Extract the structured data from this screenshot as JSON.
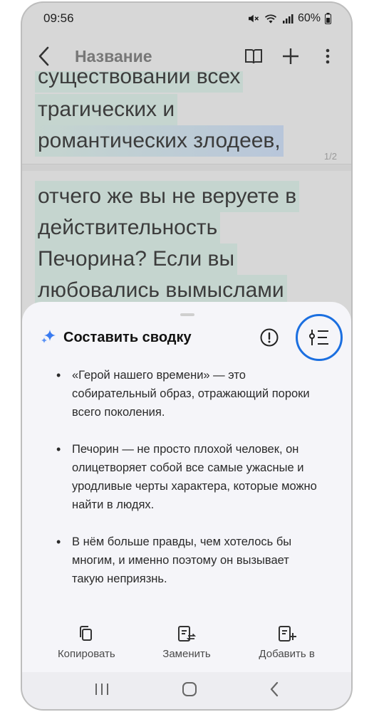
{
  "status_bar": {
    "time": "09:56",
    "battery": "60%"
  },
  "app_bar": {
    "title": "Название"
  },
  "document": {
    "page1_lines": [
      "существовании всех",
      "трагических и",
      "романтических злодеев,"
    ],
    "page_indicator": "1/2",
    "page2_lines": [
      "отчего же вы не веруете в",
      "действительность",
      "Печорина? Если вы",
      "любовались вымыслами"
    ]
  },
  "sheet": {
    "title": "Составить сводку",
    "summary": [
      "«Герой нашего времени» — это собирательный образ, отражающий пороки всего поколения.",
      "Печорин — не просто плохой человек, он олицетворяет собой все самые ужасные и уродливые черты характера, которые можно найти в людях.",
      "В нём больше правды, чем хотелось бы многим, и именно поэтому он вызывает такую неприязнь."
    ],
    "actions": {
      "copy": "Копировать",
      "replace": "Заменить",
      "add": "Добавить в"
    }
  },
  "colors": {
    "accent": "#1b6fe0",
    "ai_sparkle": "#3a7bf0"
  }
}
